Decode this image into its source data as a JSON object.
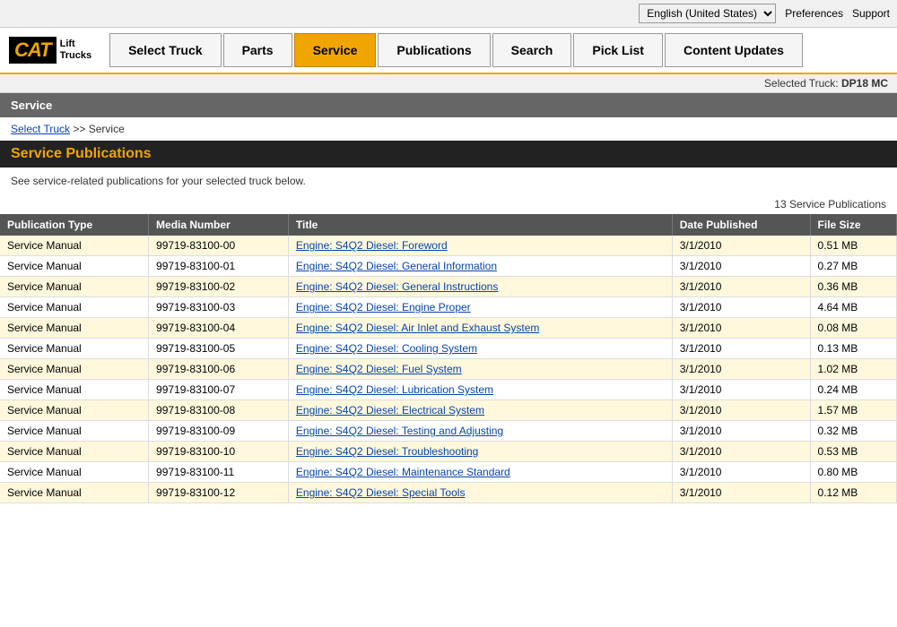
{
  "topbar": {
    "language": "English (United States)",
    "preferences_label": "Preferences",
    "support_label": "Support"
  },
  "header": {
    "logo_cat": "CAT",
    "logo_subtitle_line1": "Lift",
    "logo_subtitle_line2": "Trucks"
  },
  "nav": {
    "tabs": [
      {
        "id": "select-truck",
        "label": "Select Truck",
        "active": false
      },
      {
        "id": "parts",
        "label": "Parts",
        "active": false
      },
      {
        "id": "service",
        "label": "Service",
        "active": true
      },
      {
        "id": "publications",
        "label": "Publications",
        "active": false
      },
      {
        "id": "search",
        "label": "Search",
        "active": false
      },
      {
        "id": "pick-list",
        "label": "Pick List",
        "active": false
      },
      {
        "id": "content-updates",
        "label": "Content Updates",
        "active": false
      }
    ]
  },
  "selected_truck_bar": {
    "label": "Selected Truck:",
    "value": "DP18 MC"
  },
  "section_header": "Service",
  "breadcrumb": {
    "select_truck_label": "Select Truck",
    "separator": ">>",
    "current": "Service"
  },
  "page_title": "Service Publications",
  "description": "See service-related publications for your selected truck below.",
  "count": "13 Service Publications",
  "table": {
    "columns": [
      "Publication Type",
      "Media Number",
      "Title",
      "Date Published",
      "File Size"
    ],
    "rows": [
      {
        "type": "Service Manual",
        "media": "99719-83100-00",
        "title": "Engine: S4Q2 Diesel: Foreword",
        "date": "3/1/2010",
        "size": "0.51 MB"
      },
      {
        "type": "Service Manual",
        "media": "99719-83100-01",
        "title": "Engine: S4Q2 Diesel: General Information",
        "date": "3/1/2010",
        "size": "0.27 MB"
      },
      {
        "type": "Service Manual",
        "media": "99719-83100-02",
        "title": "Engine: S4Q2 Diesel: General Instructions",
        "date": "3/1/2010",
        "size": "0.36 MB"
      },
      {
        "type": "Service Manual",
        "media": "99719-83100-03",
        "title": "Engine: S4Q2 Diesel: Engine Proper",
        "date": "3/1/2010",
        "size": "4.64 MB"
      },
      {
        "type": "Service Manual",
        "media": "99719-83100-04",
        "title": "Engine: S4Q2 Diesel: Air Inlet and Exhaust System",
        "date": "3/1/2010",
        "size": "0.08 MB"
      },
      {
        "type": "Service Manual",
        "media": "99719-83100-05",
        "title": "Engine: S4Q2 Diesel: Cooling System",
        "date": "3/1/2010",
        "size": "0.13 MB"
      },
      {
        "type": "Service Manual",
        "media": "99719-83100-06",
        "title": "Engine: S4Q2 Diesel: Fuel System",
        "date": "3/1/2010",
        "size": "1.02 MB"
      },
      {
        "type": "Service Manual",
        "media": "99719-83100-07",
        "title": "Engine: S4Q2 Diesel: Lubrication System",
        "date": "3/1/2010",
        "size": "0.24 MB"
      },
      {
        "type": "Service Manual",
        "media": "99719-83100-08",
        "title": "Engine: S4Q2 Diesel: Electrical System",
        "date": "3/1/2010",
        "size": "1.57 MB"
      },
      {
        "type": "Service Manual",
        "media": "99719-83100-09",
        "title": "Engine: S4Q2 Diesel: Testing and Adjusting",
        "date": "3/1/2010",
        "size": "0.32 MB"
      },
      {
        "type": "Service Manual",
        "media": "99719-83100-10",
        "title": "Engine: S4Q2 Diesel: Troubleshooting",
        "date": "3/1/2010",
        "size": "0.53 MB"
      },
      {
        "type": "Service Manual",
        "media": "99719-83100-11",
        "title": "Engine: S4Q2 Diesel: Maintenance Standard",
        "date": "3/1/2010",
        "size": "0.80 MB"
      },
      {
        "type": "Service Manual",
        "media": "99719-83100-12",
        "title": "Engine: S4Q2 Diesel: Special Tools",
        "date": "3/1/2010",
        "size": "0.12 MB"
      }
    ]
  }
}
